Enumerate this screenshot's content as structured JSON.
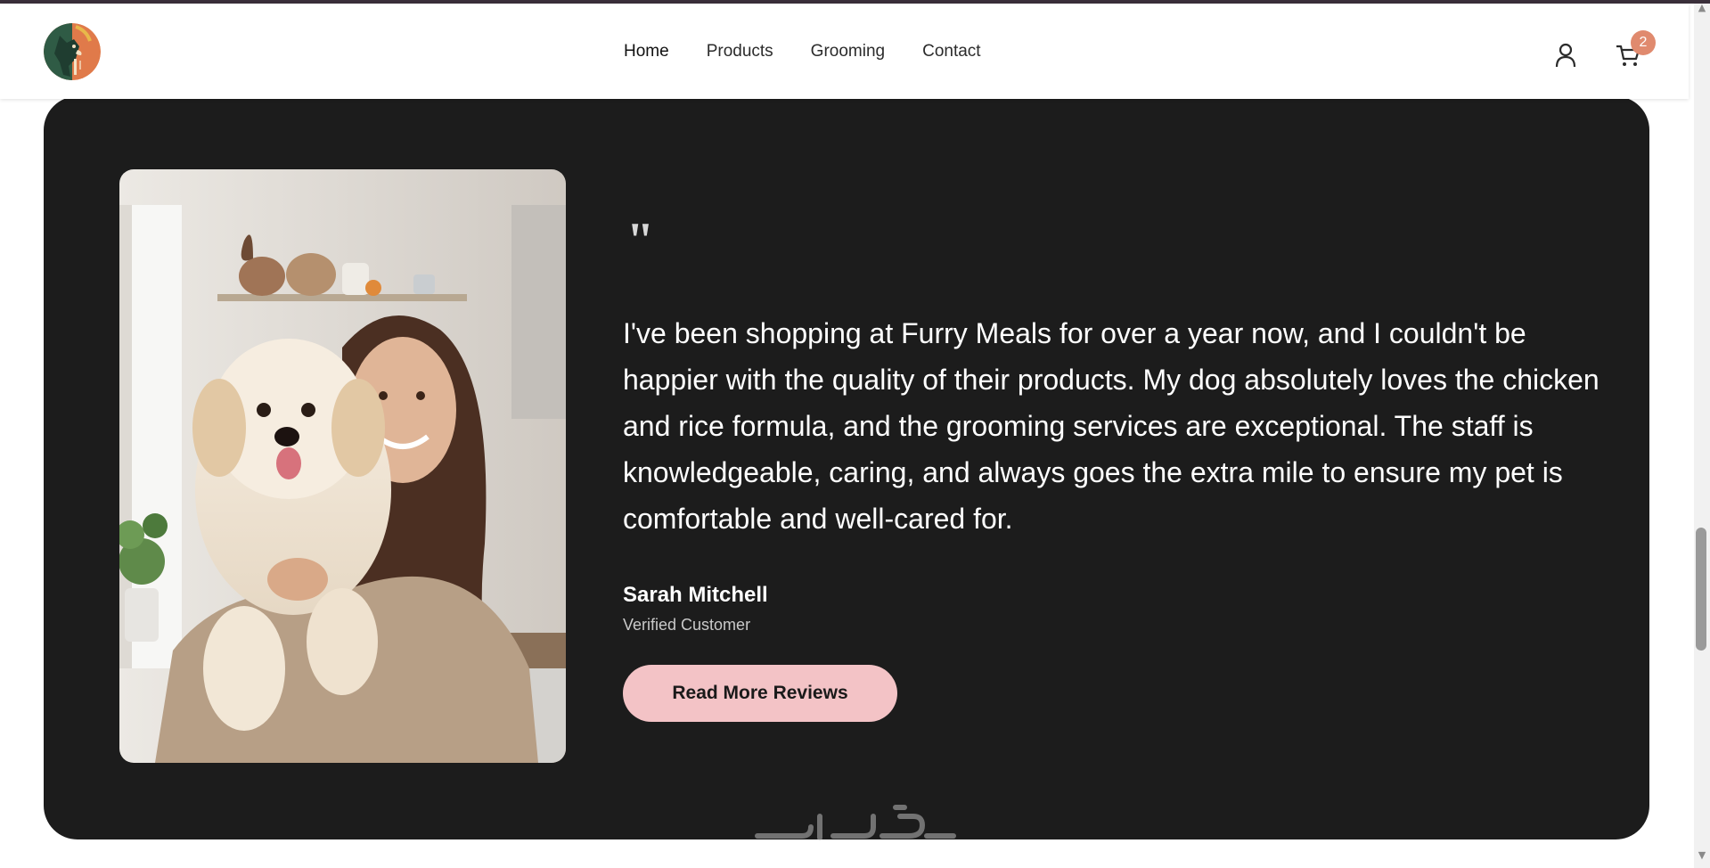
{
  "header": {
    "nav": [
      {
        "label": "Home"
      },
      {
        "label": "Products"
      },
      {
        "label": "Grooming"
      },
      {
        "label": "Contact"
      }
    ],
    "cart_count": "2",
    "icons": {
      "user": "user-icon",
      "cart": "cart-icon",
      "logo": "dog-logo"
    }
  },
  "testimonial": {
    "quote_mark": "\"",
    "quote": "I've been shopping at Furry Meals for over a year now, and I couldn't be happier with the quality of their products. My dog absolutely loves the chicken and rice formula, and the grooming services are exceptional. The staff is knowledgeable, caring, and always goes the extra mile to ensure my pet is comfortable and well-cared for.",
    "author_name": "Sarah Mitchell",
    "author_role": "Verified Customer",
    "cta_label": "Read More Reviews"
  },
  "colors": {
    "card_bg": "#1c1c1c",
    "cta_bg": "#f3c3c6",
    "badge_bg": "#e08a6e",
    "top_strip": "#3a2f3a"
  },
  "watermark": {
    "text": "خمسات"
  }
}
